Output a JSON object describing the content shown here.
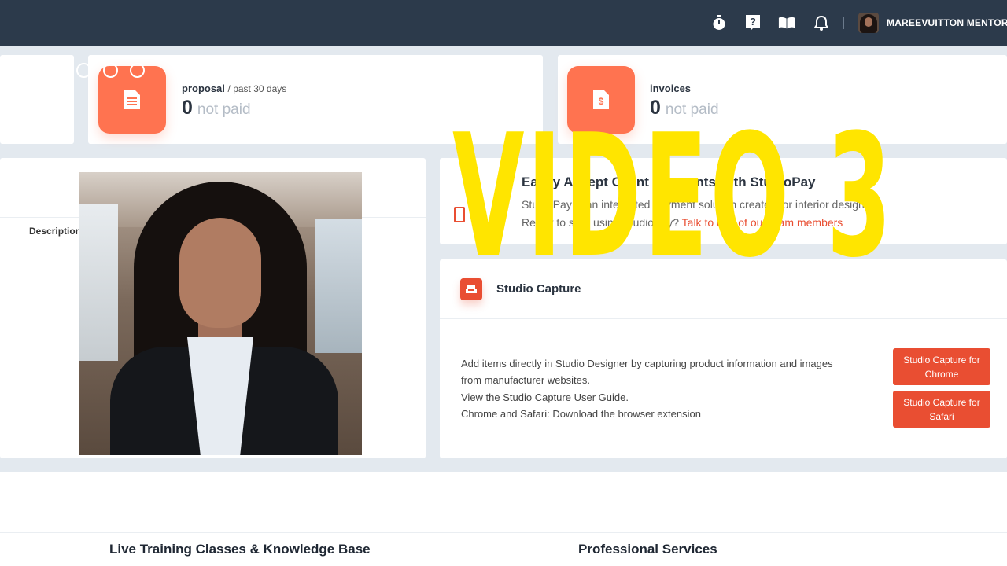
{
  "topbar": {
    "icons": [
      "stopwatch-icon",
      "help-icon",
      "book-icon",
      "bell-icon"
    ],
    "username": "MAREEVUITTON MENTORS"
  },
  "stats": {
    "proposal": {
      "label": "proposal",
      "period": "/ past 30 days",
      "value": "0",
      "status": "not paid"
    },
    "invoices": {
      "label": "invoices",
      "value": "0",
      "status": "not paid"
    }
  },
  "left_panel": {
    "column_header": "Description"
  },
  "pay_panel": {
    "title": "Easily Accept Client Payments with StudioPay",
    "line1": "StudioPay is an integrated payment solution created for interior designers.",
    "line2_prefix": "Ready to start using StudioPay?",
    "line2_link": "Talk to one of our team members"
  },
  "capture_panel": {
    "title": "Studio Capture",
    "lines": [
      "Add items directly in Studio Designer by capturing product information and images",
      "from manufacturer websites.",
      "View the Studio Capture User Guide.",
      "Chrome and Safari: Download the browser extension"
    ],
    "btn_chrome": "Studio Capture for Chrome",
    "btn_safari": "Studio Capture for Safari"
  },
  "bottom": {
    "left_heading": "Live Training Classes & Knowledge Base",
    "right_heading": "Professional Services"
  },
  "overlay": {
    "title": "VIDEO 3"
  },
  "colors": {
    "accent": "#e94e32",
    "badge": "#ff7350",
    "topbar": "#2c3a4b",
    "overlay": "#ffe500"
  }
}
